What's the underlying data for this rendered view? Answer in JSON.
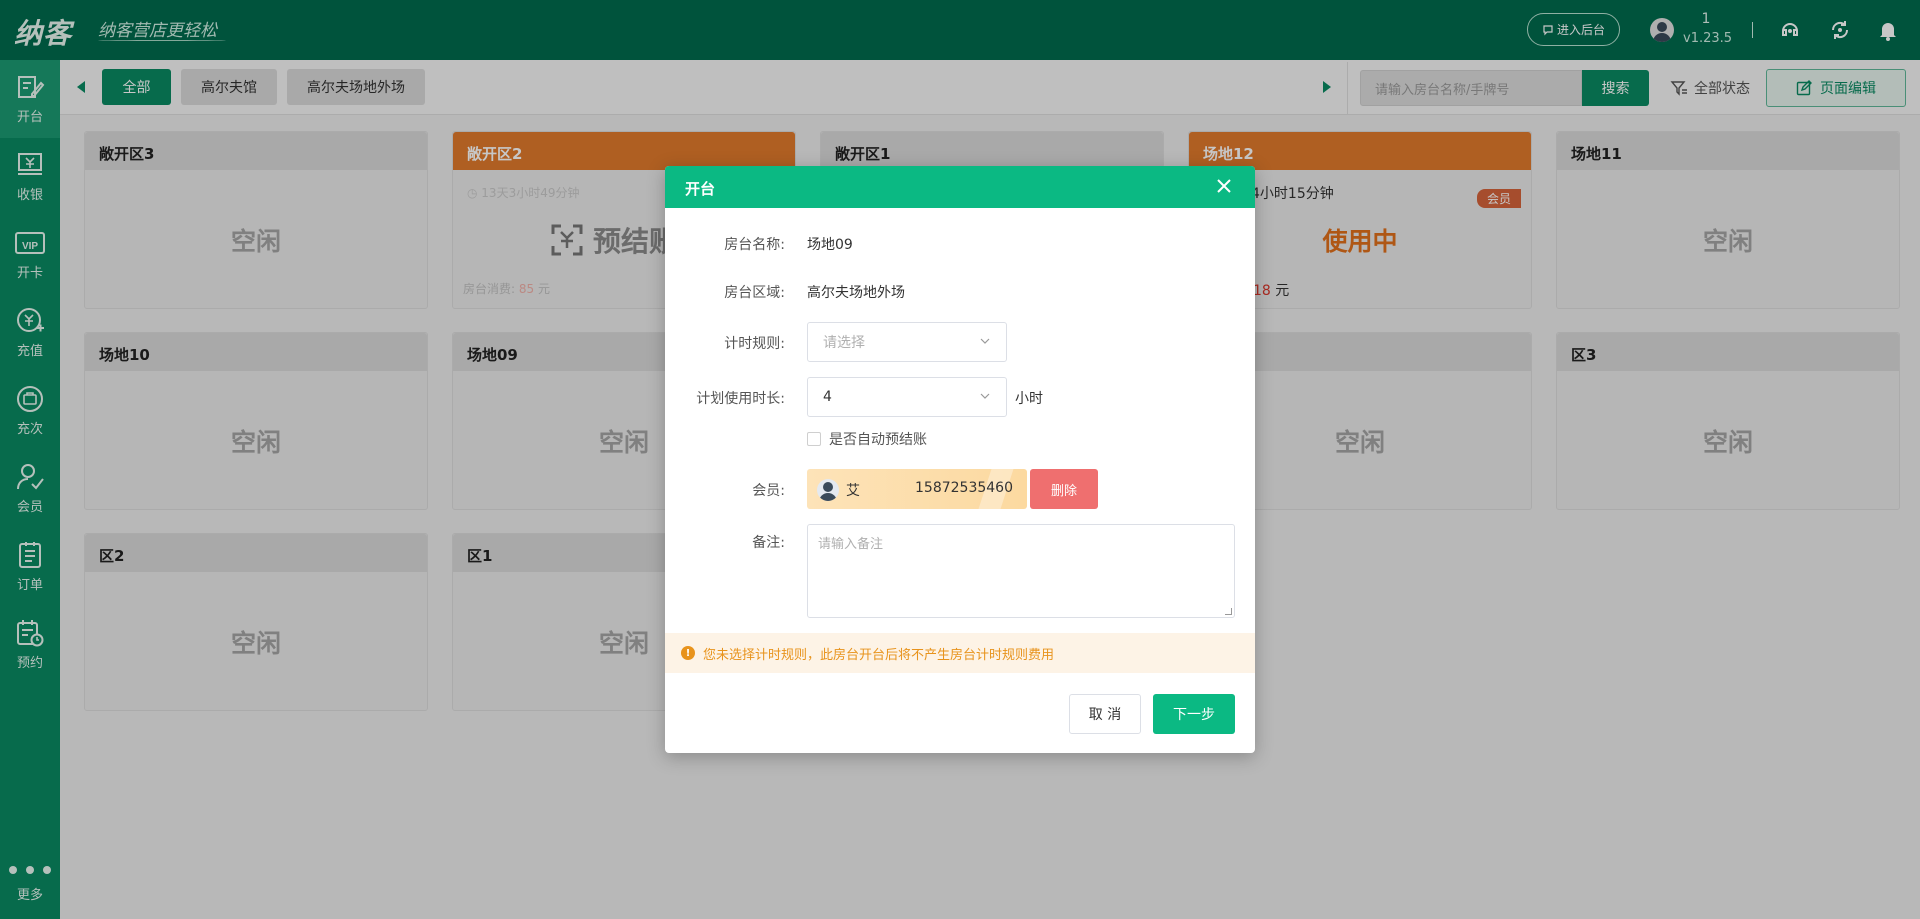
{
  "topbar": {
    "logo": "纳客",
    "slogan": "纳客营店更轻松",
    "backend_label": "进入后台",
    "user_id": "1",
    "version": "v1.23.5"
  },
  "sidebar": {
    "items": [
      {
        "label": "开台",
        "icon": "table-edit-icon"
      },
      {
        "label": "收银",
        "icon": "cashier-icon"
      },
      {
        "label": "开卡",
        "icon": "vip-card-icon"
      },
      {
        "label": "充值",
        "icon": "recharge-icon"
      },
      {
        "label": "充次",
        "icon": "recharge-count-icon"
      },
      {
        "label": "会员",
        "icon": "member-icon"
      },
      {
        "label": "订单",
        "icon": "order-icon"
      },
      {
        "label": "预约",
        "icon": "reservation-icon"
      }
    ],
    "more_label": "更多"
  },
  "filterbar": {
    "tabs": [
      "全部",
      "高尔夫馆",
      "高尔夫场地外场"
    ],
    "search_placeholder": "请输入房台名称/手牌号",
    "search_label": "搜索",
    "status_label": "全部状态",
    "edit_label": "页面编辑"
  },
  "cards": [
    {
      "name": "敞开区3",
      "state": "空闲"
    },
    {
      "name": "敞开区2",
      "state": "预结账",
      "time": "13天3小时49分钟",
      "consume_label": "房台消费:",
      "consume_value": "85",
      "consume_unit": "元"
    },
    {
      "name": "敞开区1",
      "state": ""
    },
    {
      "name": "场地12",
      "state": "使用中",
      "duration": "4小时15分钟",
      "badge": "会员",
      "cost_value": "18",
      "cost_unit": "元"
    },
    {
      "name": "场地11",
      "state": "空闲"
    },
    {
      "name": "场地10",
      "state": "空闲"
    },
    {
      "name": "场地09",
      "state": "空闲"
    },
    {
      "name": "",
      "state": "空闲"
    },
    {
      "name": "区3",
      "state": "空闲"
    },
    {
      "name": "区2",
      "state": "空闲"
    },
    {
      "name": "区1",
      "state": "空闲"
    }
  ],
  "modal": {
    "title": "开台",
    "room_name_label": "房台名称:",
    "room_name": "场地09",
    "room_area_label": "房台区域:",
    "room_area": "高尔夫场地外场",
    "timing_rule_label": "计时规则:",
    "timing_rule_placeholder": "请选择",
    "plan_duration_label": "计划使用时长:",
    "plan_duration_value": "4",
    "plan_duration_unit": "小时",
    "auto_prepay_label": "是否自动预结账",
    "member_label": "会员:",
    "member_name": "艾",
    "member_phone": "15872535460",
    "delete_label": "删除",
    "remark_label": "备注:",
    "remark_placeholder": "请输入备注",
    "warning": "您未选择计时规则，此房台开台后将不产生房台计时规则费用",
    "cancel_label": "取 消",
    "next_label": "下一步"
  },
  "colors": {
    "topbar": "#006b4e",
    "sidebar": "#0a8a62",
    "modal_header": "#0bb983",
    "busy": "#e0701c",
    "warning": "#e8931c",
    "delete": "#ef6f6f"
  }
}
